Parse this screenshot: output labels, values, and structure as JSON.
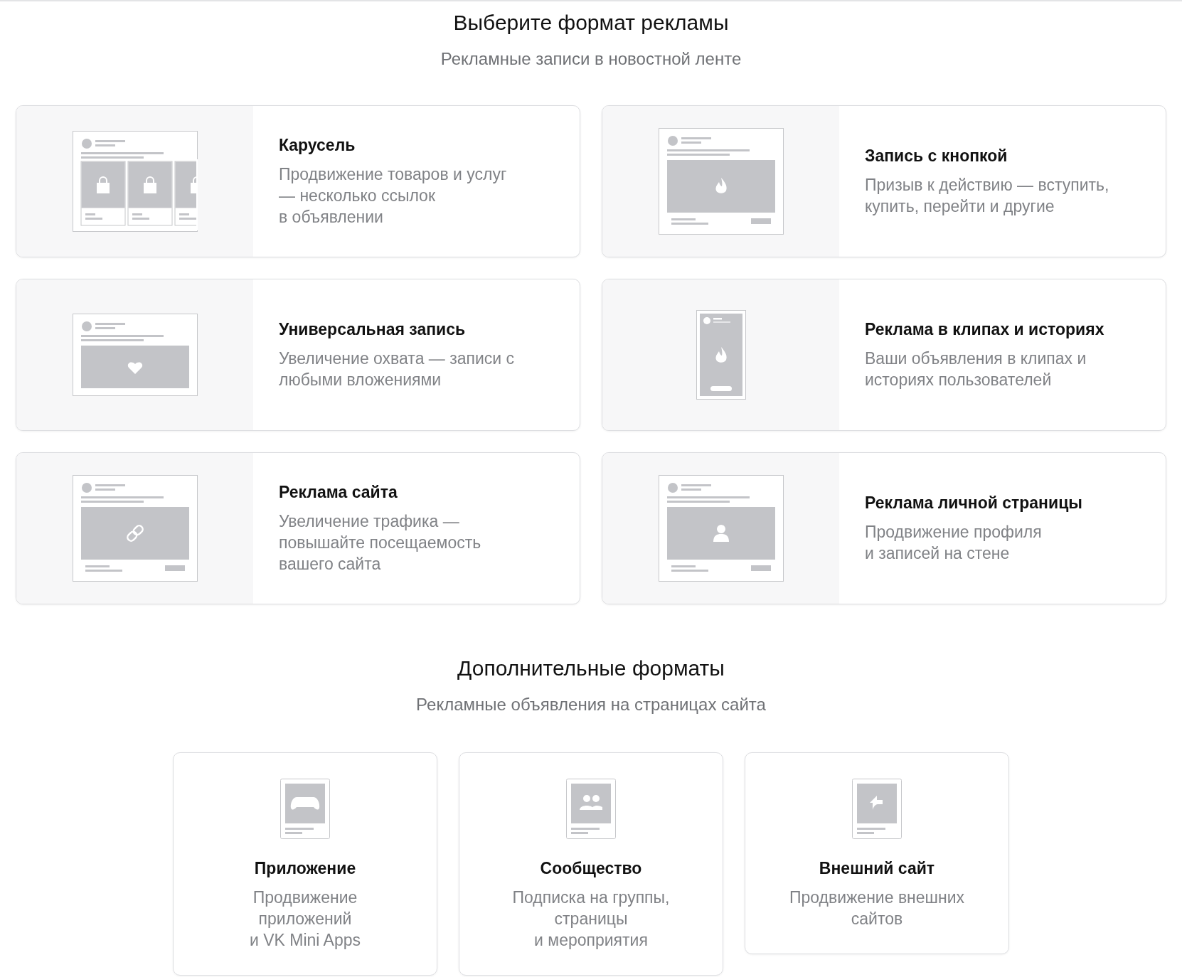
{
  "heading": "Выберите формат рекламы",
  "subheading": "Рекламные записи в новостной ленте",
  "formats": [
    {
      "kind": "carousel",
      "title": "Карусель",
      "description": "Продвижение товаров и услуг\n— несколько ссылок\nв объявлении"
    },
    {
      "kind": "button",
      "title": "Запись с кнопкой",
      "description": "Призыв к действию — вступить,\nкупить, перейти и другие"
    },
    {
      "kind": "universal",
      "title": "Универсальная запись",
      "description": "Увеличение охвата — записи с\nлюбыми вложениями"
    },
    {
      "kind": "stories",
      "title": "Реклама в клипах и историях",
      "description": "Ваши объявления в клипах и\nисториях пользователей"
    },
    {
      "kind": "site",
      "title": "Реклама сайта",
      "description": "Увеличение трафика —\nповышайте посещаемость\nвашего сайта"
    },
    {
      "kind": "profile",
      "title": "Реклама личной страницы",
      "description": "Продвижение профиля\nи записей на стене"
    }
  ],
  "extra_heading": "Дополнительные форматы",
  "extra_subheading": "Рекламные объявления на страницах сайта",
  "extra_formats": [
    {
      "kind": "app",
      "title": "Приложение",
      "description": "Продвижение\nприложений\nи VK Mini Apps"
    },
    {
      "kind": "community",
      "title": "Сообщество",
      "description": "Подписка на группы,\nстраницы\nи мероприятия"
    },
    {
      "kind": "external",
      "title": "Внешний сайт",
      "description": "Продвижение внешних\nсайтов"
    }
  ]
}
